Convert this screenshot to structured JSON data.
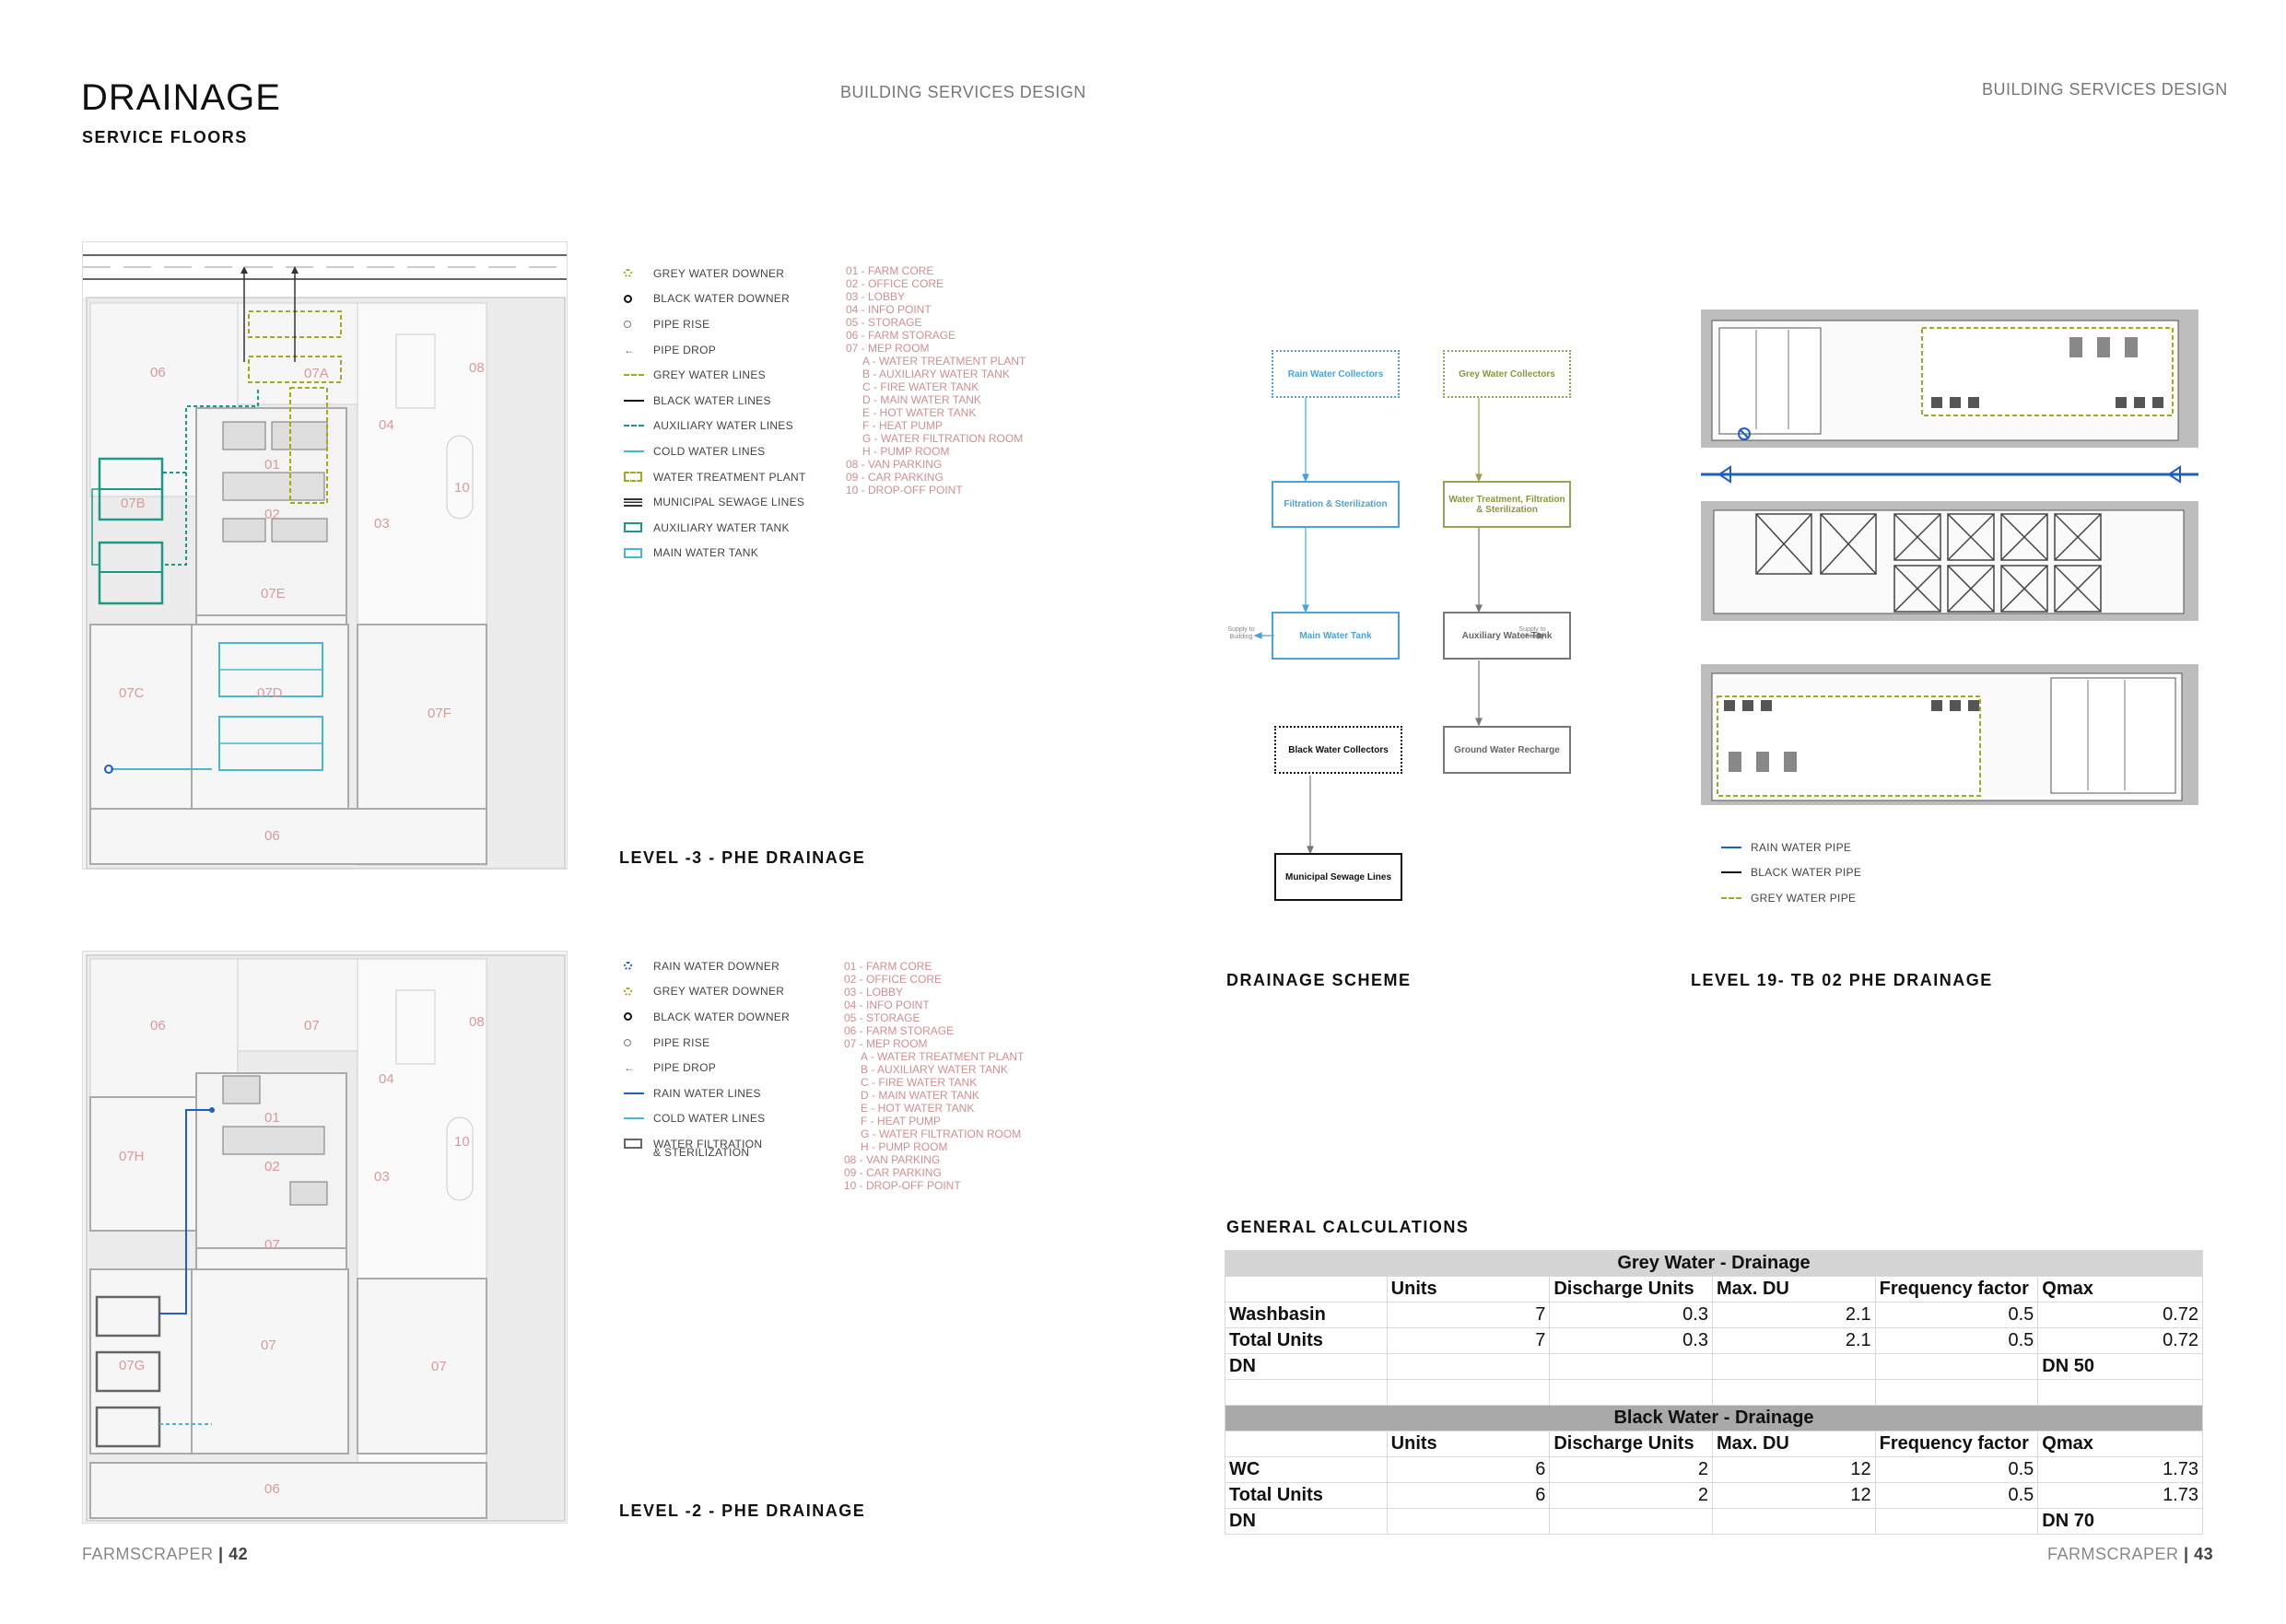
{
  "left_page": {
    "title": "DRAINAGE",
    "subtitle": "SERVICE FLOORS",
    "header": "BUILDING SERVICES DESIGN",
    "plan1": {
      "caption": "LEVEL -3 - PHE DRAINAGE",
      "rooms": {
        "r06a": "06",
        "r07a": "07A",
        "r08": "08",
        "r04": "04",
        "r01": "01",
        "r02": "02",
        "r03": "03",
        "r10": "10",
        "r07b": "07B",
        "r07e": "07E",
        "r07c": "07C",
        "r07d": "07D",
        "r07f": "07F",
        "r06b": "06"
      }
    },
    "plan2": {
      "caption": "LEVEL -2 - PHE DRAINAGE",
      "rooms": {
        "r06a": "06",
        "r07a": "07",
        "r08": "08",
        "r04": "04",
        "r01": "01",
        "r02": "02",
        "r03": "03",
        "r10": "10",
        "r07h": "07H",
        "r07b": "07",
        "r07c": "07",
        "r07g": "07G",
        "r07d": "07",
        "r06b": "06"
      }
    },
    "legend1": [
      {
        "symbol": "green-circle-icon",
        "label": "GREY WATER DOWNER"
      },
      {
        "symbol": "black-circle-icon",
        "label": "BLACK WATER DOWNER"
      },
      {
        "symbol": "pipe-rise-icon",
        "label": "PIPE RISE"
      },
      {
        "symbol": "pipe-drop-icon",
        "label": "PIPE DROP"
      },
      {
        "symbol": "grey-dash-line",
        "label": "GREY WATER LINES"
      },
      {
        "symbol": "black-line",
        "label": "BLACK WATER LINES"
      },
      {
        "symbol": "teal-dash-line",
        "label": "AUXILIARY WATER LINES"
      },
      {
        "symbol": "cyan-line",
        "label": "COLD WATER LINES"
      },
      {
        "symbol": "dashed-green-box",
        "label": "WATER TREATMENT PLANT"
      },
      {
        "symbol": "triple-line",
        "label": "MUNICIPAL SEWAGE LINES"
      },
      {
        "symbol": "teal-box",
        "label": "AUXILIARY WATER TANK"
      },
      {
        "symbol": "cyan-box",
        "label": "MAIN WATER TANK"
      }
    ],
    "legend2": [
      {
        "symbol": "blue-circle-icon",
        "label": "RAIN WATER DOWNER"
      },
      {
        "symbol": "green-circle-icon",
        "label": "GREY WATER DOWNER"
      },
      {
        "symbol": "black-circle-icon",
        "label": "BLACK WATER DOWNER"
      },
      {
        "symbol": "pipe-rise-icon",
        "label": "PIPE RISE"
      },
      {
        "symbol": "pipe-drop-icon",
        "label": "PIPE DROP"
      },
      {
        "symbol": "blue-line",
        "label": "RAIN WATER LINES"
      },
      {
        "symbol": "cyan-line",
        "label": "COLD WATER LINES"
      },
      {
        "symbol": "grey-box",
        "label": "WATER FILTRATION"
      },
      {
        "symbol": "none",
        "label": "& STERILIZATION"
      }
    ],
    "room_list": [
      {
        "text": "01 - FARM CORE",
        "indent": false
      },
      {
        "text": "02 - OFFICE CORE",
        "indent": false
      },
      {
        "text": "03 - LOBBY",
        "indent": false
      },
      {
        "text": "04 - INFO POINT",
        "indent": false
      },
      {
        "text": "05 - STORAGE",
        "indent": false
      },
      {
        "text": "06 - FARM STORAGE",
        "indent": false
      },
      {
        "text": "07 - MEP ROOM",
        "indent": false
      },
      {
        "text": "A - WATER TREATMENT PLANT",
        "indent": true
      },
      {
        "text": "B - AUXILIARY WATER TANK",
        "indent": true
      },
      {
        "text": "C - FIRE WATER TANK",
        "indent": true
      },
      {
        "text": "D - MAIN WATER TANK",
        "indent": true
      },
      {
        "text": "E - HOT WATER TANK",
        "indent": true
      },
      {
        "text": "F - HEAT PUMP",
        "indent": true
      },
      {
        "text": "G - WATER FILTRATION ROOM",
        "indent": true
      },
      {
        "text": "H - PUMP ROOM",
        "indent": true
      },
      {
        "text": "08 - VAN PARKING",
        "indent": false
      },
      {
        "text": "09 - CAR PARKING",
        "indent": false
      },
      {
        "text": "10 - DROP-OFF POINT",
        "indent": false
      }
    ],
    "footer_brand": "FARMSCRAPER",
    "footer_sep": "| ",
    "footer_page": "42"
  },
  "right_page": {
    "header": "BUILDING SERVICES DESIGN",
    "scheme_caption": "DRAINAGE SCHEME",
    "plan_caption": "LEVEL 19- TB 02 PHE DRAINAGE",
    "flowchart": {
      "rain_collectors": "Rain Water Collectors",
      "filtration": "Filtration & Sterilization",
      "main_tank": "Main Water Tank",
      "supply_left": "Supply to Building",
      "grey_collectors": "Grey Water Collectors",
      "treatment": "Water Treatment, Filtration & Sterilization",
      "aux_tank": "Auxiliary Water Tank",
      "supply_right": "Supply to Building",
      "black_collectors": "Black Water Collectors",
      "recharge": "Ground Water Recharge",
      "sewage": "Municipal Sewage Lines"
    },
    "plan_legend": [
      {
        "symbol": "blue-line",
        "label": "RAIN WATER PIPE"
      },
      {
        "symbol": "black-line",
        "label": "BLACK WATER PIPE"
      },
      {
        "symbol": "grey-dash-line",
        "label": "GREY WATER PIPE"
      }
    ],
    "calc_title": "GENERAL CALCULATIONS",
    "grey_table": {
      "title": "Grey Water - Drainage",
      "headers": [
        "",
        "Units",
        "Discharge Units",
        "Max. DU",
        "Frequency factor",
        "Qmax"
      ],
      "rows": [
        [
          "Washbasin",
          "7",
          "0.3",
          "2.1",
          "0.5",
          "0.72"
        ],
        [
          "Total Units",
          "7",
          "0.3",
          "2.1",
          "0.5",
          "0.72"
        ],
        [
          "DN",
          "",
          "",
          "",
          "",
          "DN 50"
        ]
      ]
    },
    "black_table": {
      "title": "Black Water - Drainage",
      "headers": [
        "",
        "Units",
        "Discharge Units",
        "Max. DU",
        "Frequency factor",
        "Qmax"
      ],
      "rows": [
        [
          "WC",
          "6",
          "2",
          "12",
          "0.5",
          "1.73"
        ],
        [
          "Total Units",
          "6",
          "2",
          "12",
          "0.5",
          "1.73"
        ],
        [
          "DN",
          "",
          "",
          "",
          "",
          "DN 70"
        ]
      ]
    },
    "footer_brand": "FARMSCRAPER",
    "footer_sep": "| ",
    "footer_page": "43"
  },
  "colors": {
    "grey_water": "#a3a81f",
    "black_water": "#111111",
    "auxiliary": "#1a9a86",
    "cold_water": "#4bb6cf",
    "rain_water": "#1f5fc4",
    "room_label": "#d99a9a"
  }
}
